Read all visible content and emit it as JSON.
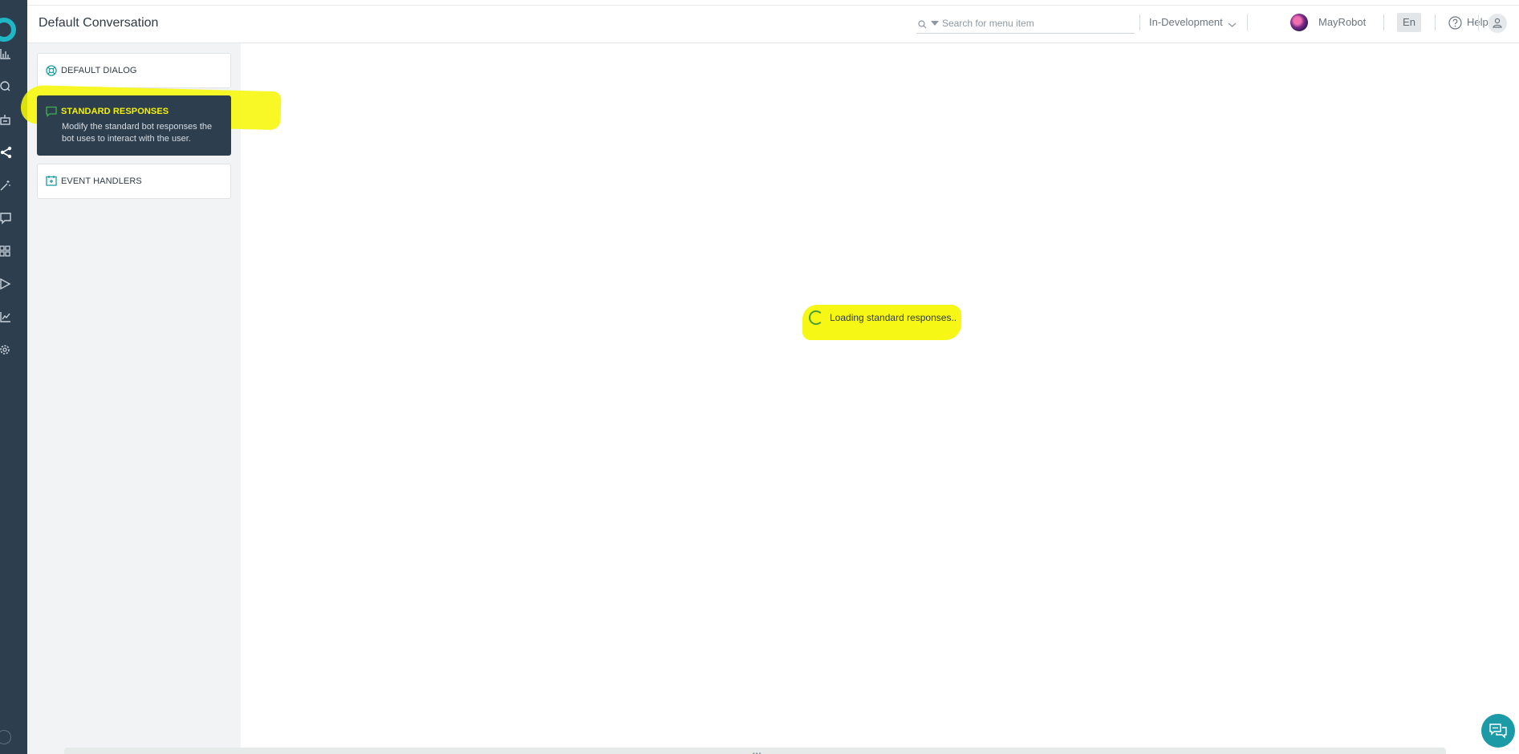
{
  "header": {
    "title": "Default Conversation",
    "search_placeholder": "Search for menu item",
    "environment": "In-Development",
    "user_name": "MayRobot",
    "language": "En",
    "help_label": "Help"
  },
  "panel": {
    "items": [
      {
        "title": "DEFAULT DIALOG",
        "icon": "lifebuoy-icon"
      },
      {
        "title": "STANDARD RESPONSES",
        "description": "Modify the standard bot responses the bot uses to interact with the user.",
        "icon": "message-square-icon",
        "selected": true
      },
      {
        "title": "EVENT HANDLERS",
        "icon": "calendar-event-icon"
      }
    ]
  },
  "main": {
    "loading_text": "Loading standard responses.."
  },
  "colors": {
    "rail": "#2d3e4f",
    "accent": "#1fb6c6",
    "highlight": "#f6f707",
    "selected_title": "#f4f10a"
  }
}
